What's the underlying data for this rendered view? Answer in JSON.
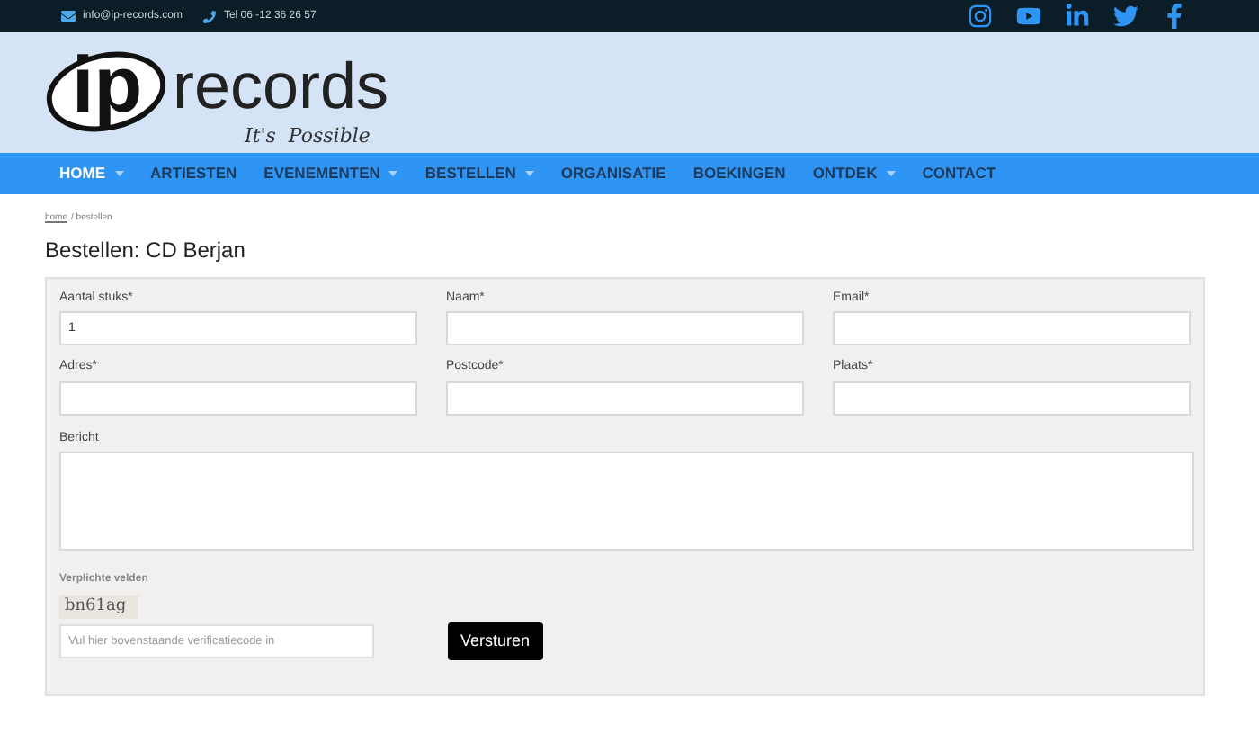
{
  "topbar": {
    "email": "info@ip-records.com",
    "phone": "Tel 06 -12 36 26 57"
  },
  "logo": {
    "mark": "ip",
    "name": "records",
    "tagline": "It's  Possible"
  },
  "nav": [
    {
      "label": "HOME",
      "selected": true,
      "dropdown": true
    },
    {
      "label": "ARTIESTEN",
      "selected": false,
      "dropdown": false
    },
    {
      "label": "EVENEMENTEN",
      "selected": false,
      "dropdown": true
    },
    {
      "label": "BESTELLEN",
      "selected": false,
      "dropdown": true
    },
    {
      "label": "ORGANISATIE",
      "selected": false,
      "dropdown": false
    },
    {
      "label": "BOEKINGEN",
      "selected": false,
      "dropdown": false
    },
    {
      "label": "ONTDEK",
      "selected": false,
      "dropdown": true
    },
    {
      "label": "CONTACT",
      "selected": false,
      "dropdown": false
    }
  ],
  "breadcrumb": {
    "home": "home",
    "current": "/ bestellen"
  },
  "title": "Bestellen: CD Berjan",
  "fields": [
    {
      "label": "Aantal stuks*",
      "value": "1"
    },
    {
      "label": "Naam*"
    },
    {
      "label": "Email*"
    },
    {
      "label": "Adres*"
    },
    {
      "label": "Postcode*"
    },
    {
      "label": "Plaats*"
    }
  ],
  "message": {
    "label": "Bericht"
  },
  "required_note": "Verplichte velden",
  "captcha": {
    "code": "bn61ag",
    "placeholder": "Vul hier bovenstaande verificatiecode in"
  },
  "submit": "Versturen"
}
